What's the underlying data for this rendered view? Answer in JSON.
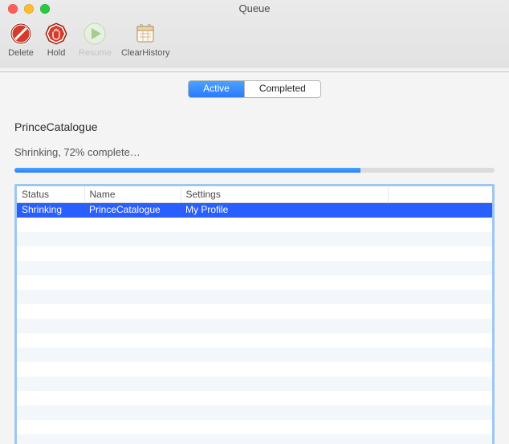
{
  "window": {
    "title": "Queue"
  },
  "toolbar": {
    "delete_label": "Delete",
    "hold_label": "Hold",
    "resume_label": "Resume",
    "clear_history_label": "ClearHistory"
  },
  "tabs": {
    "active_label": "Active",
    "completed_label": "Completed"
  },
  "job": {
    "name": "PrinceCatalogue",
    "status_text": "Shrinking, 72% complete…",
    "progress_percent": 72
  },
  "table": {
    "headers": {
      "status": "Status",
      "name": "Name",
      "settings": "Settings"
    },
    "rows": [
      {
        "status": "Shrinking",
        "name": "PrinceCatalogue",
        "settings": "My Profile",
        "selected": true
      }
    ]
  },
  "colors": {
    "accent": "#2a7cff",
    "selection": "#2a5fff",
    "focus_ring": "#9dc7f2"
  }
}
